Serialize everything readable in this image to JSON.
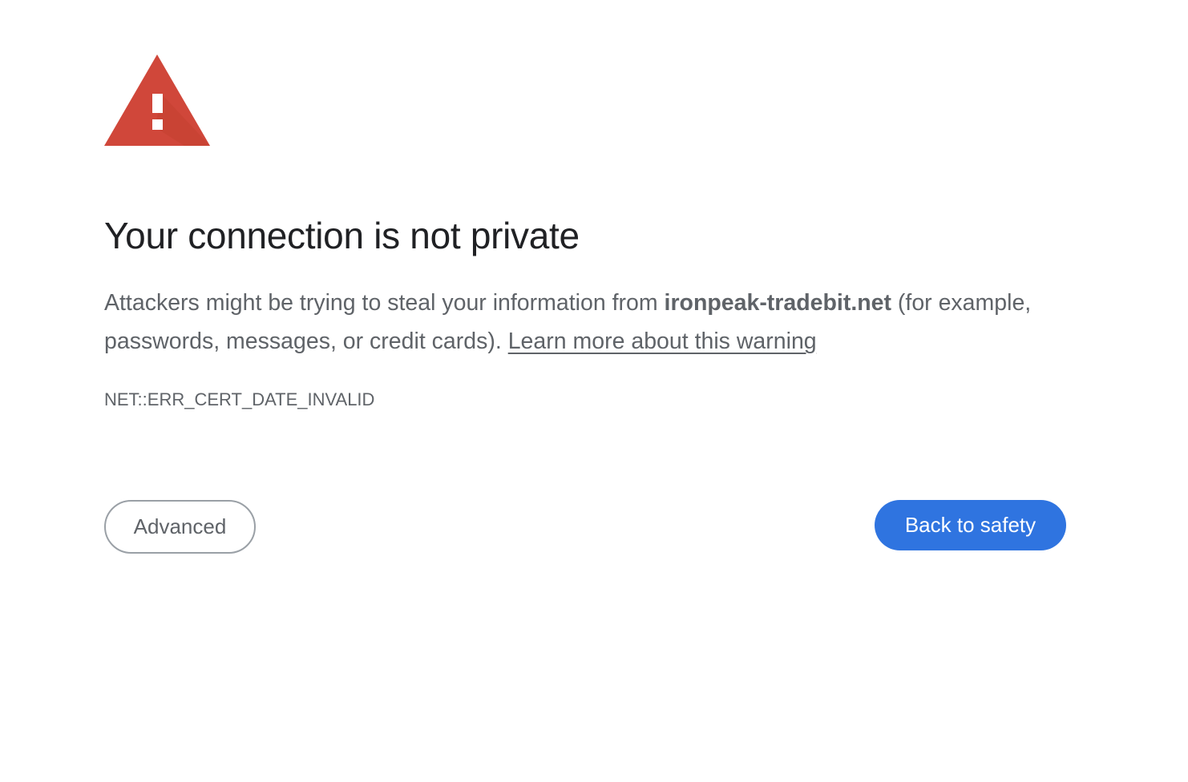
{
  "icon": {
    "name": "warning-triangle-icon",
    "color": "#d0473a",
    "shadow_color": "#b23b2f",
    "mark_color": "#ffffff"
  },
  "title": "Your connection is not private",
  "explanation": {
    "prefix": "Attackers might be trying to steal your information from ",
    "domain": "ironpeak-tradebit.net",
    "suffix": " (for example, passwords, messages, or credit cards). ",
    "learn_more_link": "Learn more about this warning"
  },
  "error_code": "NET::ERR_CERT_DATE_INVALID",
  "buttons": {
    "advanced_label": "Advanced",
    "back_label": "Back to safety"
  },
  "colors": {
    "primary_button": "#2f74e0",
    "text_primary": "#202124",
    "text_secondary": "#5f6368",
    "button_border": "#9aa0a6"
  }
}
